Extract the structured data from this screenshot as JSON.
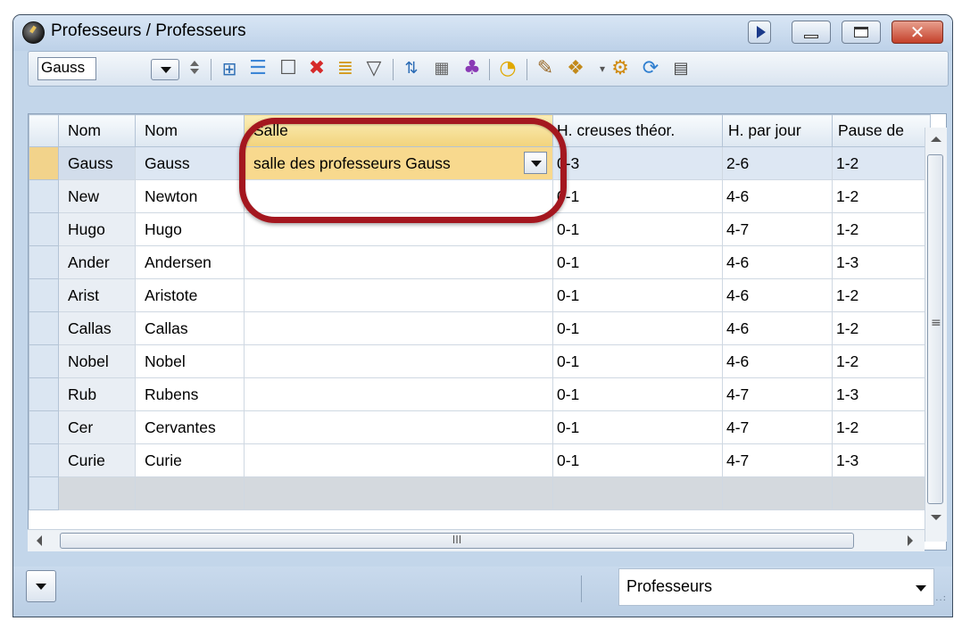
{
  "window": {
    "title": "Professeurs / Professeurs"
  },
  "toolbar": {
    "selector_value": "Gauss",
    "icons": [
      "insert-table-icon",
      "list-icon",
      "new-icon",
      "delete-icon",
      "sort-icon",
      "filter-icon",
      "sort-az-icon",
      "grid-icon",
      "people-icon",
      "clock-icon",
      "edit-icon",
      "settings-page-icon",
      "gear-icon",
      "refresh-icon",
      "calendar-icon"
    ]
  },
  "grid": {
    "columns": [
      "Nom",
      "Nom",
      "Salle",
      "H. creuses théor.",
      "H. par jour",
      "Pause de"
    ],
    "rows": [
      [
        "Gauss",
        "Gauss",
        "salle des professeurs Gauss",
        "0-3",
        "2-6",
        "1-2"
      ],
      [
        "New",
        "Newton",
        "",
        "0-1",
        "4-6",
        "1-2"
      ],
      [
        "Hugo",
        "Hugo",
        "",
        "0-1",
        "4-7",
        "1-2"
      ],
      [
        "Ander",
        "Andersen",
        "",
        "0-1",
        "4-6",
        "1-3"
      ],
      [
        "Arist",
        "Aristote",
        "",
        "0-1",
        "4-6",
        "1-2"
      ],
      [
        "Callas",
        "Callas",
        "",
        "0-1",
        "4-6",
        "1-2"
      ],
      [
        "Nobel",
        "Nobel",
        "",
        "0-1",
        "4-6",
        "1-2"
      ],
      [
        "Rub",
        "Rubens",
        "",
        "0-1",
        "4-7",
        "1-3"
      ],
      [
        "Cer",
        "Cervantes",
        "",
        "0-1",
        "4-7",
        "1-2"
      ],
      [
        "Curie",
        "Curie",
        "",
        "0-1",
        "4-7",
        "1-3"
      ]
    ],
    "selected_row": 0
  },
  "scrollbar": {
    "h_grip": "III"
  },
  "statusbar": {
    "view_select": "Professeurs",
    "grip": "..:"
  },
  "colors": {
    "highlight_ring": "#a4171f",
    "selected_cell": "#f8d98e",
    "window_frame": "#c3d6ea"
  }
}
